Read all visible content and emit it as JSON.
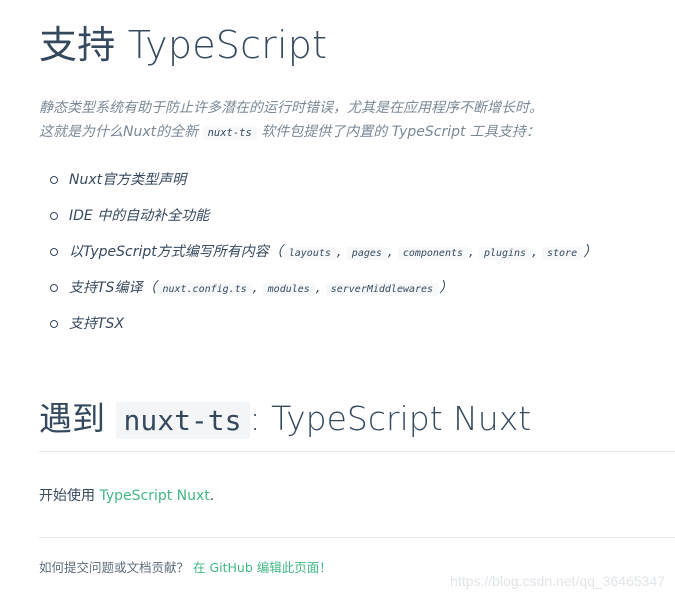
{
  "heading": {
    "cn": "支持",
    "en": "TypeScript"
  },
  "intro": {
    "line1": "静态类型系统有助于防止许多潜在的运行时错误，尤其是在应用程序不断增长时。",
    "line2_before": "这就是为什么Nuxt的全新",
    "line2_code": "nuxt-ts",
    "line2_after": "软件包提供了内置的 TypeScript 工具支持："
  },
  "features": {
    "item1": "Nuxt官方类型声明",
    "item2": "IDE 中的自动补全功能",
    "item3": {
      "text": "以TypeScript方式编写所有内容",
      "open": "（",
      "close": "）",
      "codes": [
        "layouts",
        "pages",
        "components",
        "plugins",
        "store"
      ]
    },
    "item4": {
      "text": "支持TS编译",
      "open": "（",
      "close": "）",
      "codes": [
        "nuxt.config.ts",
        "modules",
        "serverMiddlewares"
      ]
    },
    "item5": "支持TSX"
  },
  "section": {
    "cn": "遇到",
    "code": "nuxt-ts",
    "suffix": ": TypeScript Nuxt"
  },
  "get_started": {
    "text": "开始使用",
    "link": "TypeScript Nuxt",
    "period": "."
  },
  "contribute": {
    "text": "如何提交问题或文档贡献？",
    "link": "在 GitHub 编辑此页面！"
  },
  "watermark": "https://blog.csdn.net/qq_36465347",
  "colors": {
    "text": "#35495e",
    "accent": "#41b883",
    "muted": "#7a8896"
  }
}
